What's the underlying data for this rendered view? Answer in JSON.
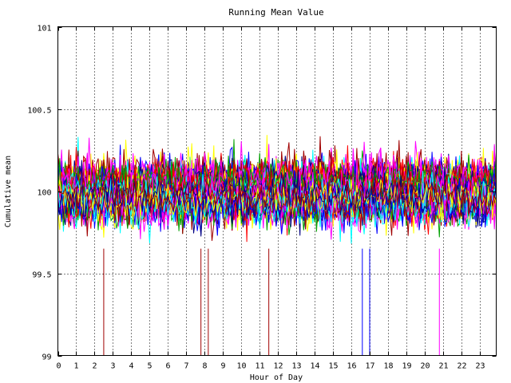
{
  "chart_data": {
    "type": "line",
    "title": "Running Mean Value",
    "xlabel": "Hour of Day",
    "ylabel": "Cumulative mean",
    "xlim": [
      0,
      23.9
    ],
    "ylim": [
      99,
      101
    ],
    "x_ticks": [
      0,
      1,
      2,
      3,
      4,
      5,
      6,
      7,
      8,
      9,
      10,
      11,
      12,
      13,
      14,
      15,
      16,
      17,
      18,
      19,
      20,
      21,
      22,
      23
    ],
    "x_tick_labels": [
      "0",
      "1",
      "2",
      "3",
      "4",
      "5",
      "6",
      "7",
      "8",
      "9",
      "10",
      "11",
      "12",
      "13",
      "14",
      "15",
      "16",
      "17",
      "18",
      "19",
      "20",
      "21",
      "22",
      "23"
    ],
    "y_ticks": [
      99,
      99.5,
      100,
      100.5,
      101
    ],
    "y_tick_labels": [
      "99",
      "99.5",
      "100",
      "100.5",
      "101"
    ],
    "grid": true,
    "legend": "none",
    "series_count": 80,
    "sample_step_hours": 0.1,
    "center": 100.0,
    "typical_range": [
      99.5,
      100.6
    ],
    "colors": [
      "#ff0000",
      "#00a000",
      "#0000ff",
      "#ff00ff",
      "#00ffff",
      "#ffff00",
      "#000080",
      "#a00000"
    ],
    "spikes": [
      {
        "x": 2.5,
        "y_low": 99.0,
        "color": "#a00000"
      },
      {
        "x": 7.8,
        "y_low": 99.0,
        "color": "#a00000"
      },
      {
        "x": 8.2,
        "y_low": 99.0,
        "color": "#a00000"
      },
      {
        "x": 11.5,
        "y_low": 99.0,
        "color": "#a00000"
      },
      {
        "x": 16.6,
        "y_low": 99.0,
        "color": "#0000ff"
      },
      {
        "x": 17.0,
        "y_low": 99.0,
        "color": "#0000ff"
      },
      {
        "x": 20.8,
        "y_low": 99.0,
        "color": "#ff00ff"
      }
    ]
  }
}
